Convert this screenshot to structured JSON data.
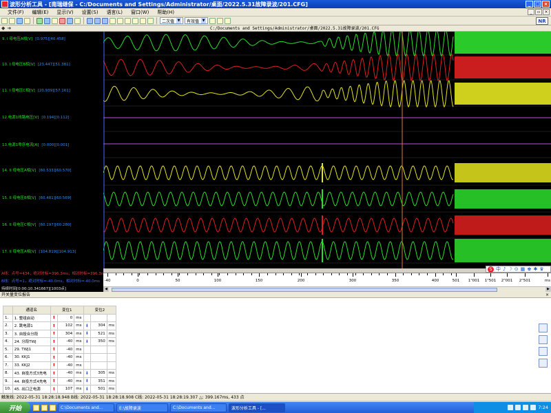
{
  "window": {
    "title": "波形分析工具 - [南瑞继保 - C:/Documents and Settings/Administrator/桌面/2022.5.31故障录波/201.CFG]"
  },
  "menu": [
    "文件(F)",
    "编辑(E)",
    "显示(V)",
    "设置(S)",
    "语言(L)",
    "窗口(W)",
    "帮助(H)"
  ],
  "toolbar": {
    "select1": "二次值",
    "select2": "有效值",
    "logo": "NR"
  },
  "path": "C:/Documents and Settings/Administrator/桌面/2022.5.31故障录波/201.CFG",
  "channels": [
    {
      "label": "9. I 母电压A相[V]",
      "vals": "[0.975][40.458]"
    },
    {
      "label": "10. I 母电压B相[V]",
      "vals": "[23.447][51.381]"
    },
    {
      "label": "11. I 母电压C相[V]",
      "vals": "[20.939][57.161]"
    },
    {
      "label": "12.电源1线路电压[V]",
      "vals": "[0.194][0.112]"
    },
    {
      "label": "13.电源1零序电流[A]",
      "vals": "[0.000][0.001]"
    },
    {
      "label": "14. II 母电压A相[V]",
      "vals": "[60.533][60.570]"
    },
    {
      "label": "15. II 母电压B相[V]",
      "vals": "[60.481][60.569]"
    },
    {
      "label": "16. II 母电压C相[V]",
      "vals": "[60.197][60.280]"
    },
    {
      "label": "17. II 母电压A相[V]",
      "vals": "[104.819][104.913]"
    }
  ],
  "channel_colors": [
    "#2de02d",
    "#e02020",
    "#e6e620",
    "#c050e0",
    "#c050e0",
    "#e6e620",
    "#2de02d",
    "#e02020",
    "#2de02d"
  ],
  "info": {
    "line1": "A线：点号=434，绝对时标=396.3ms，相对时标=396.3ms",
    "line2": "B线：点号=1，绝对时标=-40.0ms，相对时标=-40.0ms",
    "line3": "持续时间[0:00:10.341667][1003点]"
  },
  "axis": {
    "ticks": [
      "-40",
      "0",
      "50",
      "100",
      "150",
      "200",
      "300",
      "350",
      "400",
      "501",
      "1\"001",
      "1\"501",
      "2\"001",
      "2\"501",
      "ms"
    ]
  },
  "tray_mini": {
    "s": "S",
    "items": [
      "中",
      "♪",
      "☽",
      "⊙",
      "▦",
      "♚",
      "✱",
      "♛"
    ]
  },
  "switch_panel": {
    "title": "开关量变位报告",
    "close": "×",
    "headers": [
      "",
      "通道名",
      "变位1",
      "变位2"
    ],
    "rows": [
      {
        "idx": "1.",
        "name": "1. 整组启动",
        "v1": "0",
        "v1u": "ms",
        "v1dir": "up",
        "v2": "",
        "v2u": "",
        "v2dir": ""
      },
      {
        "idx": "2.",
        "name": "2. 跳电源1",
        "v1": "102",
        "v1u": "ms",
        "v1dir": "up",
        "v2": "304",
        "v2u": "ms",
        "v2dir": "down"
      },
      {
        "idx": "3.",
        "name": "3. 自投合分段",
        "v1": "304",
        "v1u": "ms",
        "v1dir": "up",
        "v2": "521",
        "v2u": "ms",
        "v2dir": "down"
      },
      {
        "idx": "4.",
        "name": "24. 分段TWJ",
        "v1": "-40",
        "v1u": "ms",
        "v1dir": "up",
        "v2": "350",
        "v2u": "ms",
        "v2dir": "down"
      },
      {
        "idx": "5.",
        "name": "29. TWJ1",
        "v1": "-40",
        "v1u": "ms",
        "v1dir": "up",
        "v2": "",
        "v2u": "",
        "v2dir": ""
      },
      {
        "idx": "6.",
        "name": "30. KKJ1",
        "v1": "-40",
        "v1u": "ms",
        "v1dir": "up",
        "v2": "",
        "v2u": "",
        "v2dir": ""
      },
      {
        "idx": "7.",
        "name": "33. KKJ2",
        "v1": "-40",
        "v1u": "ms",
        "v1dir": "up",
        "v2": "",
        "v2u": "",
        "v2dir": ""
      },
      {
        "idx": "8.",
        "name": "43. 自投方式3充电",
        "v1": "-40",
        "v1u": "ms",
        "v1dir": "up",
        "v2": "305",
        "v2u": "ms",
        "v2dir": "down"
      },
      {
        "idx": "9.",
        "name": "44. 自投方式4充电",
        "v1": "-40",
        "v1u": "ms",
        "v1dir": "up",
        "v2": "351",
        "v2u": "ms",
        "v2dir": "down"
      },
      {
        "idx": "10.",
        "name": "45. 出口正电源",
        "v1": "107",
        "v1u": "ms",
        "v1dir": "up",
        "v2": "501",
        "v2u": "ms",
        "v2dir": "down"
      }
    ]
  },
  "status": {
    "text": "触发线: 2022-05-31 18:28:18.948  B线: 2022-05-31 18:28:18.908  C线: 2022-05-31 18:28:19.307  △: 399.167ms, 433 点"
  },
  "taskbar": {
    "start": "开始",
    "tasks": [
      "C:\\Documents and...",
      "E:\\故障录波",
      "C:\\Documents and...",
      "波形分析工具 - [..."
    ],
    "time": "7:24"
  }
}
